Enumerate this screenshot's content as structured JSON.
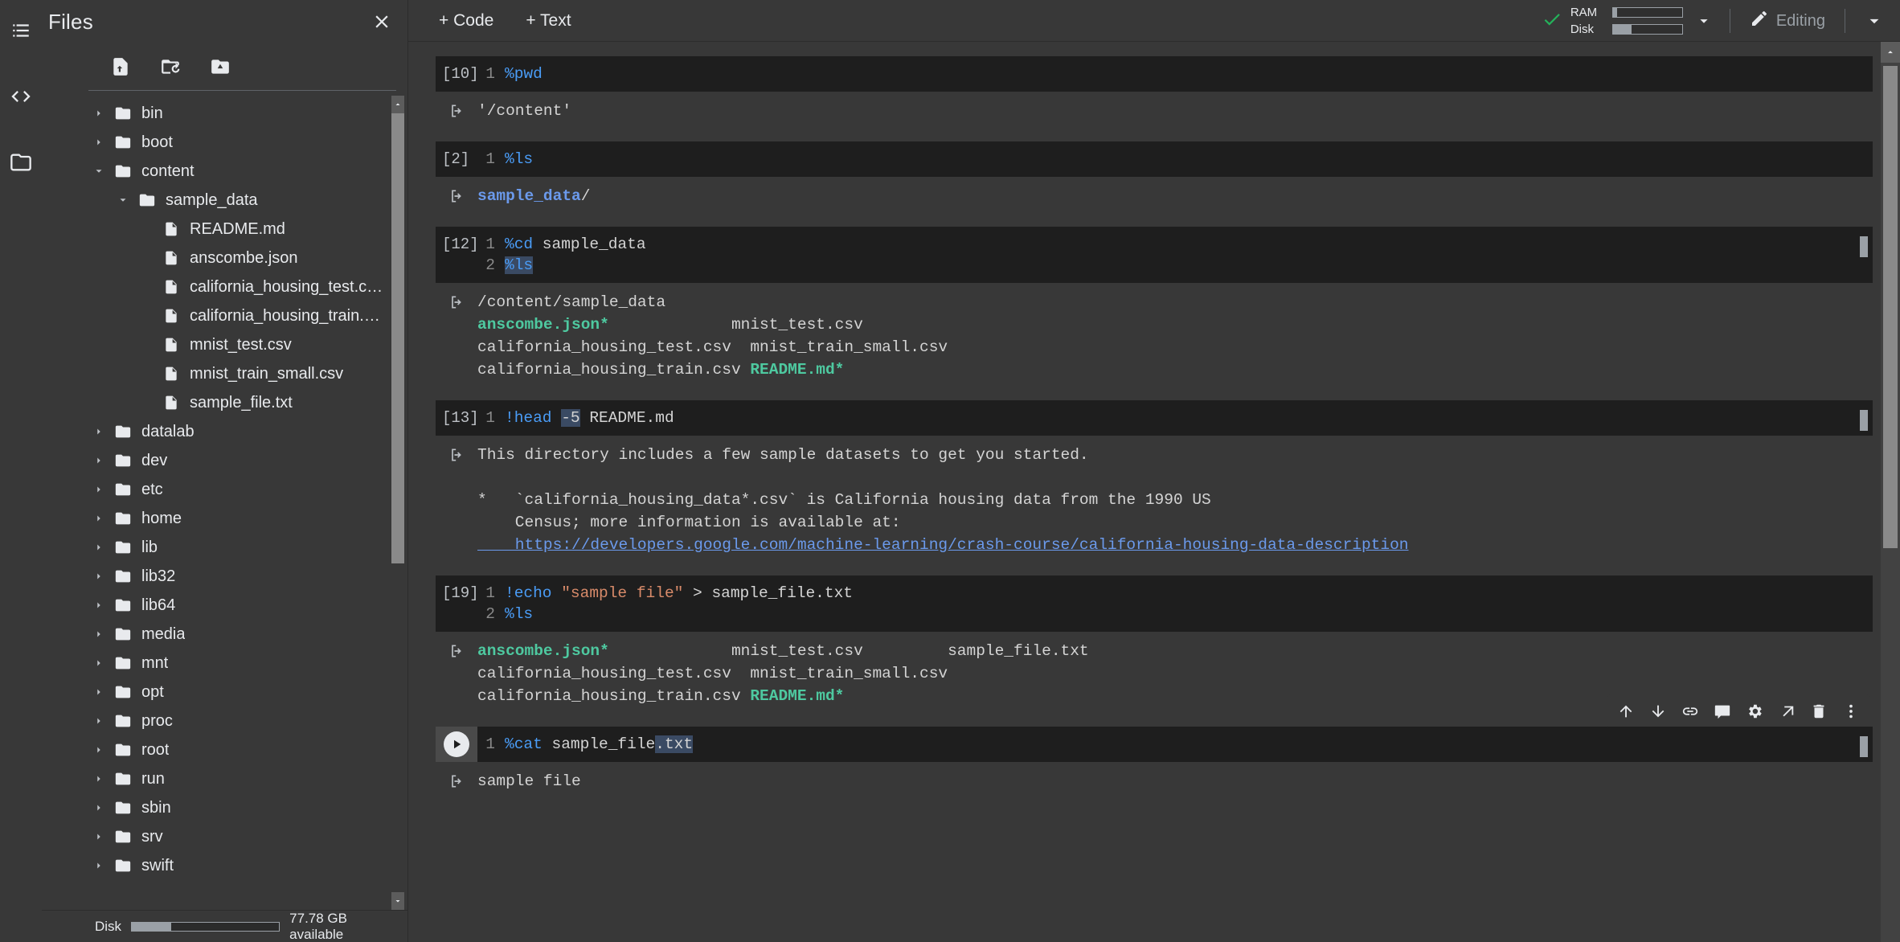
{
  "rail": {
    "items": [
      {
        "name": "table-of-contents",
        "icon": "list-icon"
      },
      {
        "name": "code-snippets",
        "icon": "code-brackets-icon"
      },
      {
        "name": "files",
        "icon": "folder-icon"
      }
    ]
  },
  "files_panel": {
    "title": "Files",
    "close_label": "×",
    "actions": [
      {
        "name": "upload-to-session-storage",
        "icon": "upload-file-icon"
      },
      {
        "name": "refresh",
        "icon": "refresh-folder-icon"
      },
      {
        "name": "mount-drive",
        "icon": "drive-folder-icon"
      }
    ],
    "tree": [
      {
        "label": "bin",
        "type": "folder",
        "depth": 0,
        "expanded": false
      },
      {
        "label": "boot",
        "type": "folder",
        "depth": 0,
        "expanded": false
      },
      {
        "label": "content",
        "type": "folder",
        "depth": 0,
        "expanded": true
      },
      {
        "label": "sample_data",
        "type": "folder",
        "depth": 1,
        "expanded": true
      },
      {
        "label": "README.md",
        "type": "file",
        "depth": 2
      },
      {
        "label": "anscombe.json",
        "type": "file",
        "depth": 2
      },
      {
        "label": "california_housing_test.c…",
        "type": "file",
        "depth": 2
      },
      {
        "label": "california_housing_train.c…",
        "type": "file",
        "depth": 2
      },
      {
        "label": "mnist_test.csv",
        "type": "file",
        "depth": 2
      },
      {
        "label": "mnist_train_small.csv",
        "type": "file",
        "depth": 2
      },
      {
        "label": "sample_file.txt",
        "type": "file",
        "depth": 2
      },
      {
        "label": "datalab",
        "type": "folder",
        "depth": 0,
        "expanded": false
      },
      {
        "label": "dev",
        "type": "folder",
        "depth": 0,
        "expanded": false
      },
      {
        "label": "etc",
        "type": "folder",
        "depth": 0,
        "expanded": false
      },
      {
        "label": "home",
        "type": "folder",
        "depth": 0,
        "expanded": false
      },
      {
        "label": "lib",
        "type": "folder",
        "depth": 0,
        "expanded": false
      },
      {
        "label": "lib32",
        "type": "folder",
        "depth": 0,
        "expanded": false
      },
      {
        "label": "lib64",
        "type": "folder",
        "depth": 0,
        "expanded": false
      },
      {
        "label": "media",
        "type": "folder",
        "depth": 0,
        "expanded": false
      },
      {
        "label": "mnt",
        "type": "folder",
        "depth": 0,
        "expanded": false
      },
      {
        "label": "opt",
        "type": "folder",
        "depth": 0,
        "expanded": false
      },
      {
        "label": "proc",
        "type": "folder",
        "depth": 0,
        "expanded": false
      },
      {
        "label": "root",
        "type": "folder",
        "depth": 0,
        "expanded": false
      },
      {
        "label": "run",
        "type": "folder",
        "depth": 0,
        "expanded": false
      },
      {
        "label": "sbin",
        "type": "folder",
        "depth": 0,
        "expanded": false
      },
      {
        "label": "srv",
        "type": "folder",
        "depth": 0,
        "expanded": false
      },
      {
        "label": "swift",
        "type": "folder",
        "depth": 0,
        "expanded": false
      }
    ],
    "disk": {
      "label": "Disk",
      "available_text": "77.78 GB available",
      "fill_percent": 27
    }
  },
  "toolbar": {
    "add_code_label": "+ Code",
    "add_text_label": "+ Text",
    "connected_icon": "check-icon",
    "ram_label": "RAM",
    "disk_label": "Disk",
    "ram_fill_percent": 6,
    "disk_fill_percent": 27,
    "resources_caret_icon": "chevron-down-icon",
    "editing_label": "Editing",
    "editing_icon": "pencil-icon",
    "expand_icon": "chevron-down-icon"
  },
  "cell_actions": [
    {
      "name": "move-cell-up",
      "icon": "arrow-up-icon"
    },
    {
      "name": "move-cell-down",
      "icon": "arrow-down-icon"
    },
    {
      "name": "link-to-cell",
      "icon": "link-icon"
    },
    {
      "name": "add-comment",
      "icon": "comment-icon"
    },
    {
      "name": "cell-settings",
      "icon": "gear-icon"
    },
    {
      "name": "open-in-new-tab",
      "icon": "open-in-new-icon"
    },
    {
      "name": "delete-cell",
      "icon": "trash-icon"
    },
    {
      "name": "more-options",
      "icon": "more-vert-icon"
    }
  ],
  "cells": [
    {
      "exec_count": "[10]",
      "active": false,
      "has_scrollmark": false,
      "lines": [
        [
          {
            "t": "%pwd",
            "c": "k-magic"
          }
        ]
      ],
      "output": [
        [
          {
            "t": "'/content'",
            "c": ""
          }
        ]
      ]
    },
    {
      "exec_count": "[2]",
      "active": false,
      "has_scrollmark": false,
      "lines": [
        [
          {
            "t": "%ls",
            "c": "k-magic"
          }
        ]
      ],
      "output": [
        [
          {
            "t": "sample_data",
            "c": "o-blue"
          },
          {
            "t": "/",
            "c": ""
          }
        ]
      ]
    },
    {
      "exec_count": "[12]",
      "active": false,
      "has_scrollmark": true,
      "lines": [
        [
          {
            "t": "%cd",
            "c": "k-magic"
          },
          {
            "t": " sample_data",
            "c": ""
          }
        ],
        [
          {
            "t": "%ls",
            "c": "k-magic sel"
          }
        ]
      ],
      "output": [
        [
          {
            "t": "/content/sample_data",
            "c": ""
          }
        ],
        [
          {
            "t": "anscombe.json*",
            "c": "o-green"
          },
          {
            "t": "             mnist_test.csv",
            "c": ""
          }
        ],
        [
          {
            "t": "california_housing_test.csv  mnist_train_small.csv",
            "c": ""
          }
        ],
        [
          {
            "t": "california_housing_train.csv ",
            "c": ""
          },
          {
            "t": "README.md*",
            "c": "o-green"
          }
        ]
      ]
    },
    {
      "exec_count": "[13]",
      "active": false,
      "has_scrollmark": true,
      "lines": [
        [
          {
            "t": "!head",
            "c": "k-bang"
          },
          {
            "t": " ",
            "c": ""
          },
          {
            "t": "-5",
            "c": "k-num sel"
          },
          {
            "t": " README.md",
            "c": ""
          }
        ]
      ],
      "output": [
        [
          {
            "t": "This directory includes a few sample datasets to get you started.",
            "c": ""
          }
        ],
        [
          {
            "t": "",
            "c": ""
          }
        ],
        [
          {
            "t": "*   `california_housing_data*.csv` is California housing data from the 1990 US",
            "c": ""
          }
        ],
        [
          {
            "t": "    Census; more information is available at:",
            "c": ""
          }
        ],
        [
          {
            "t": "    https://developers.google.com/machine-learning/crash-course/california-housing-data-description",
            "c": "o-link"
          }
        ]
      ]
    },
    {
      "exec_count": "[19]",
      "active": false,
      "has_scrollmark": false,
      "lines": [
        [
          {
            "t": "!echo",
            "c": "k-bang"
          },
          {
            "t": " ",
            "c": ""
          },
          {
            "t": "\"sample file\"",
            "c": "k-str"
          },
          {
            "t": " > sample_file.txt",
            "c": ""
          }
        ],
        [
          {
            "t": "%ls",
            "c": "k-magic"
          }
        ]
      ],
      "output": [
        [
          {
            "t": "anscombe.json*",
            "c": "o-green"
          },
          {
            "t": "             mnist_test.csv         sample_file.txt",
            "c": ""
          }
        ],
        [
          {
            "t": "california_housing_test.csv  mnist_train_small.csv",
            "c": ""
          }
        ],
        [
          {
            "t": "california_housing_train.csv ",
            "c": ""
          },
          {
            "t": "README.md*",
            "c": "o-green"
          }
        ]
      ]
    },
    {
      "exec_count": "",
      "active": true,
      "has_scrollmark": true,
      "run_icon": "play-icon",
      "show_actions": true,
      "lines": [
        [
          {
            "t": "%cat",
            "c": "k-magic"
          },
          {
            "t": " sample_file",
            "c": ""
          },
          {
            "t": ".txt",
            "c": "sel"
          }
        ]
      ],
      "output": [
        [
          {
            "t": "sample file",
            "c": ""
          }
        ]
      ]
    }
  ]
}
